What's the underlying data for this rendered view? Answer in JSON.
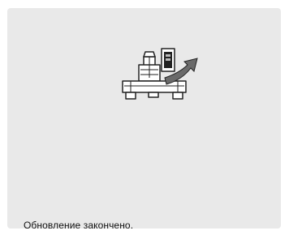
{
  "status": {
    "message": "Обновление закончено."
  },
  "illustration": {
    "icon": "machine-update-icon",
    "arrow_icon": "upward-arrow-icon",
    "colors": {
      "outline": "#222222",
      "fill": "#ffffff",
      "accent": "#6a6a6a"
    }
  }
}
